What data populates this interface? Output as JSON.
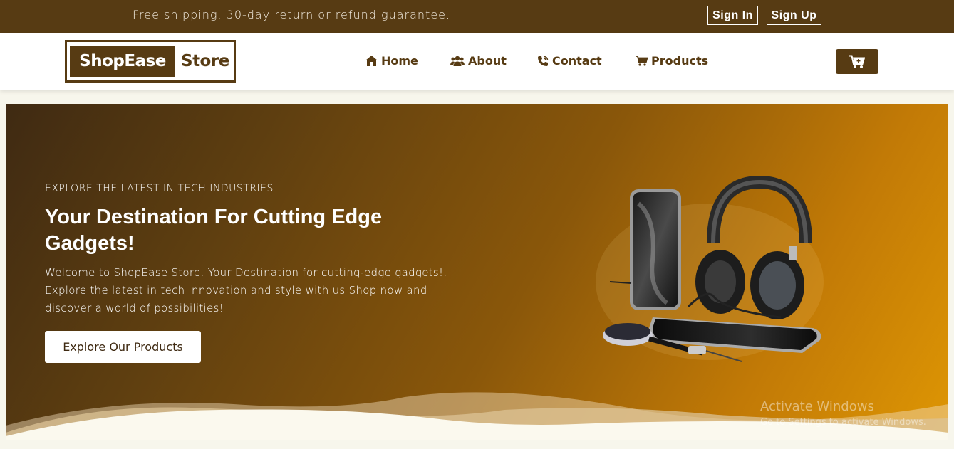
{
  "topbar": {
    "promo": "Free shipping, 30-day return or refund guarantee.",
    "sign_in": "Sign In",
    "sign_up": "Sign Up"
  },
  "navbar": {
    "logo_main": "ShopEase",
    "logo_sub": "Store",
    "links": [
      {
        "label": "Home",
        "icon": "home-icon"
      },
      {
        "label": "About",
        "icon": "users-icon"
      },
      {
        "label": "Contact",
        "icon": "phone-icon"
      },
      {
        "label": "Products",
        "icon": "cart-icon"
      }
    ],
    "cart_icon": "cart-plus-icon"
  },
  "hero": {
    "eyebrow": "EXPLORE THE LATEST IN TECH INDUSTRIES",
    "headline": "Your Destination For Cutting Edge Gadgets!",
    "description": "Welcome to ShopEase Store. Your Destination for cutting-edge gadgets!. Explore the latest in tech innovation and style with us Shop now and discover a world of possibilities!",
    "cta": "Explore Our Products"
  },
  "watermark": {
    "title": "Activate Windows",
    "subtitle": "Go to Settings to activate Windows."
  },
  "colors": {
    "brand": "#573b13",
    "accent": "#de9604"
  }
}
